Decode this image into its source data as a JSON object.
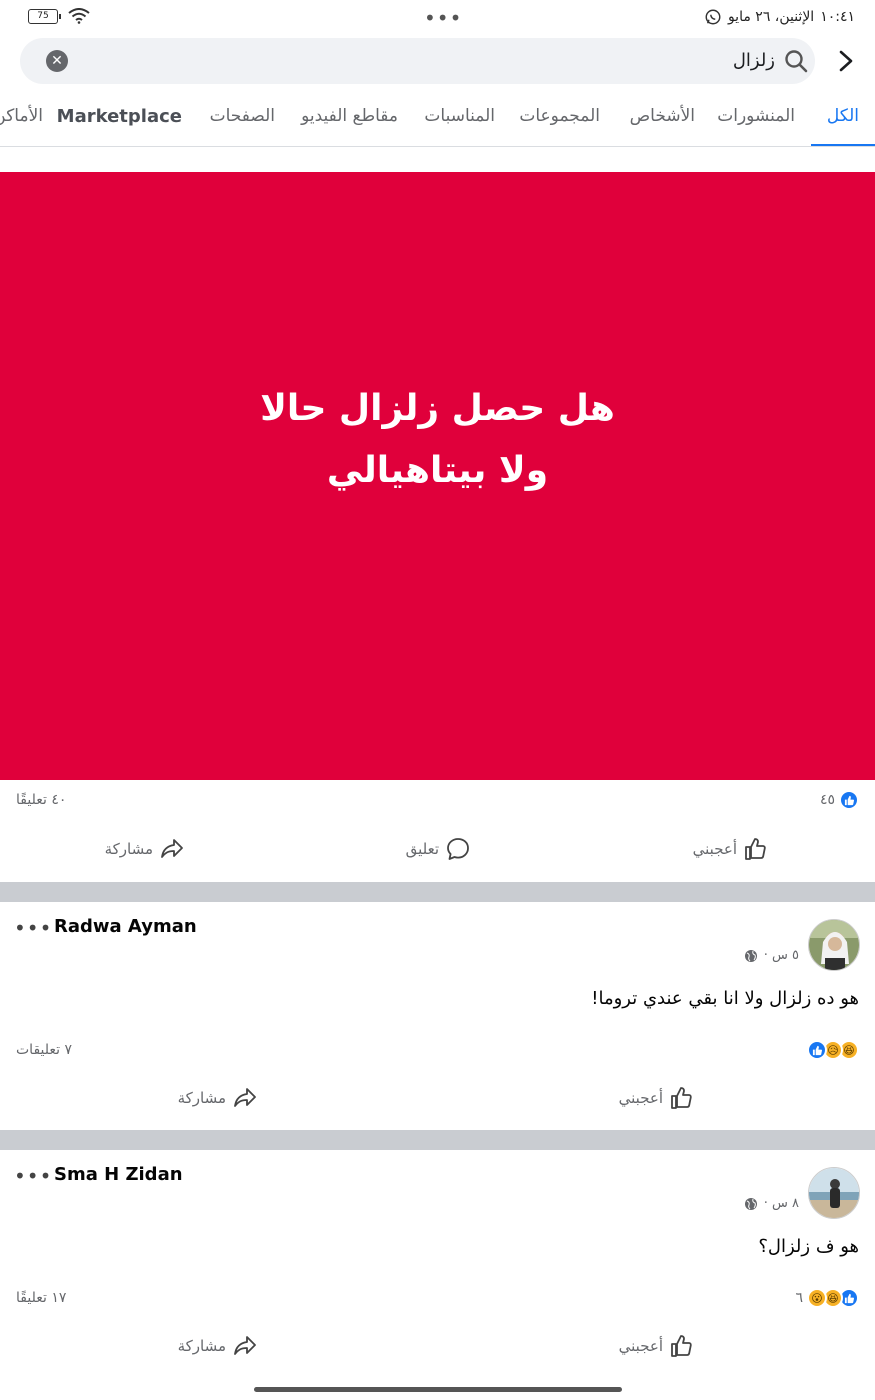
{
  "status_bar": {
    "time": "١٠:٤١",
    "date": "الإثنين، ٢٦ مايو",
    "battery": "75"
  },
  "search": {
    "query": "زلزال"
  },
  "tabs": [
    {
      "label": "الكل",
      "active": true
    },
    {
      "label": "المنشورات"
    },
    {
      "label": "الأشخاص"
    },
    {
      "label": "المجموعات"
    },
    {
      "label": "المناسبات"
    },
    {
      "label": "مقاطع الفيديو"
    },
    {
      "label": "الصفحات"
    },
    {
      "label": "Marketplace"
    },
    {
      "label": "الأماكن"
    }
  ],
  "post1": {
    "text_line1": "هل حصل زلزال حالا",
    "text_line2": "ولا بيتاهيالي",
    "background_color": "#e0003b",
    "reactions_count": "٤٥",
    "comments_count": "٤٠ تعليقًا",
    "like_label": "أعجبني",
    "comment_label": "تعليق",
    "share_label": "مشاركة"
  },
  "post2": {
    "author": "Radwa Ayman",
    "time": "٥ س ·",
    "text": "هو ده زلزال ولا انا بقي عندي تروما!",
    "comments_count": "٧ تعليقات",
    "like_label": "أعجبني",
    "share_label": "مشاركة",
    "reactions": [
      "like-icon",
      "sad-icon",
      "haha-icon"
    ]
  },
  "post3": {
    "author": "Sma H Zidan",
    "time": "٨ س ·",
    "text": "هو ف زلزال؟",
    "reactions_count": "٦",
    "comments_count": "١٧ تعليقًا",
    "like_label": "أعجبني",
    "share_label": "مشاركة",
    "reactions": [
      "like-icon",
      "haha-icon",
      "wow-icon"
    ]
  },
  "colors": {
    "accent": "#1877f2",
    "divider": "#c9ccd1",
    "muted_text": "#65676b"
  }
}
